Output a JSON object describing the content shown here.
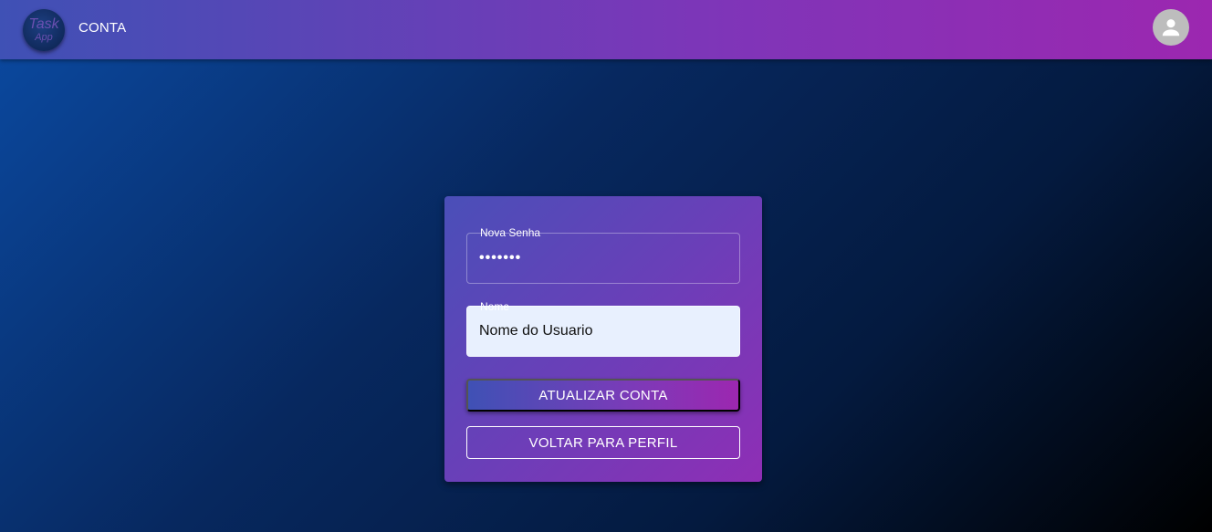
{
  "header": {
    "logo_line1": "Task",
    "logo_line2": "App",
    "title": "CONTA",
    "avatar_icon": "account-circle-icon"
  },
  "form": {
    "password_label": "Nova Senha",
    "password_value": "•••••••",
    "name_label": "Nome",
    "name_value": "Nome do Usuario",
    "submit_label": "ATUALIZAR CONTA",
    "back_label": "VOLTAR PARA PERFIL"
  },
  "colors": {
    "appbar_start": "#3f51b5",
    "appbar_end": "#9c27b0",
    "background_start": "#0b4aa2",
    "background_end": "#000000",
    "autofill_field": "#e8f0fe"
  }
}
